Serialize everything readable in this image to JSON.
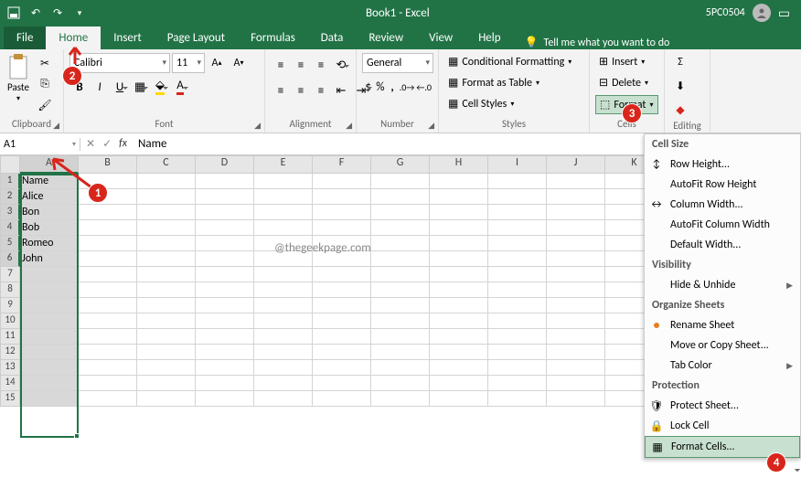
{
  "window": {
    "title": "Book1  -  Excel",
    "user": "5PC0504"
  },
  "tabs": {
    "file": "File",
    "home": "Home",
    "insert": "Insert",
    "layout": "Page Layout",
    "formulas": "Formulas",
    "data": "Data",
    "review": "Review",
    "view": "View",
    "help": "Help",
    "tellme": "Tell me what you want to do"
  },
  "ribbon": {
    "clipboard": {
      "paste": "Paste",
      "label": "Clipboard"
    },
    "font": {
      "name": "Calibri",
      "size": "11",
      "label": "Font"
    },
    "alignment": {
      "label": "Alignment"
    },
    "number": {
      "format": "General",
      "label": "Number"
    },
    "styles": {
      "cond": "Conditional Formatting",
      "table": "Format as Table",
      "cell": "Cell Styles",
      "label": "Styles"
    },
    "cells": {
      "insert": "Insert",
      "delete": "Delete",
      "format": "Format",
      "label": "Cells"
    },
    "editing": {
      "label": "Editing"
    }
  },
  "formula_bar": {
    "cell": "A1",
    "value": "Name"
  },
  "grid": {
    "columns": [
      "A",
      "B",
      "C",
      "D",
      "E",
      "F",
      "G",
      "H",
      "I",
      "J",
      "K"
    ],
    "rows": [
      "1",
      "2",
      "3",
      "4",
      "5",
      "6",
      "7",
      "8",
      "9",
      "10",
      "11",
      "12",
      "13",
      "14",
      "15"
    ],
    "colA": [
      "Name",
      "Alice",
      "Bon",
      "Bob",
      "Romeo",
      "John"
    ]
  },
  "menu": {
    "sec1": "Cell Size",
    "row_h": "Row Height...",
    "auto_rh": "AutoFit Row Height",
    "col_w": "Column Width...",
    "auto_cw": "AutoFit Column Width",
    "def_w": "Default Width...",
    "sec2": "Visibility",
    "hide": "Hide & Unhide",
    "sec3": "Organize Sheets",
    "rename": "Rename Sheet",
    "move": "Move or Copy Sheet...",
    "tabcolor": "Tab Color",
    "sec4": "Protection",
    "protect": "Protect Sheet...",
    "lock": "Lock Cell",
    "fmt_cells": "Format Cells..."
  },
  "annotations": {
    "b1": "1",
    "b2": "2",
    "b3": "3",
    "b4": "4"
  },
  "watermark": "@thegeekpage.com"
}
